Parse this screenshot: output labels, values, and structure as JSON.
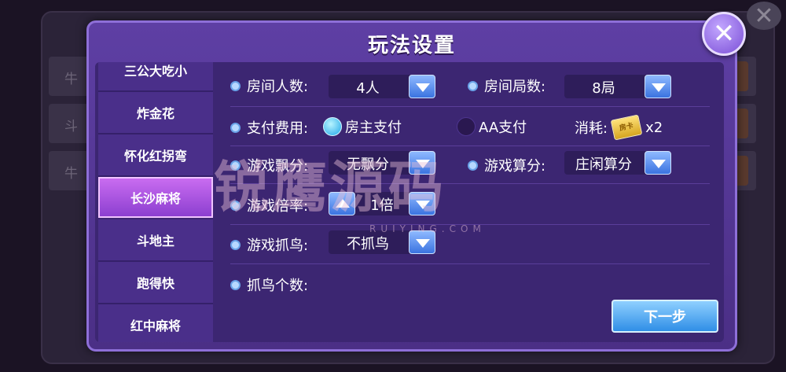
{
  "background": {
    "rows": [
      "牛",
      "斗",
      "牛"
    ],
    "close_symbol": "✕"
  },
  "dialog": {
    "title": "玩法设置",
    "close_symbol": "✕"
  },
  "sidebar": {
    "items": [
      {
        "label": "三公大吃小",
        "active": false
      },
      {
        "label": "炸金花",
        "active": false
      },
      {
        "label": "怀化红拐弯",
        "active": false
      },
      {
        "label": "长沙麻将",
        "active": true
      },
      {
        "label": "斗地主",
        "active": false
      },
      {
        "label": "跑得快",
        "active": false
      },
      {
        "label": "红中麻将",
        "active": false
      }
    ]
  },
  "options": {
    "players": {
      "label": "房间人数:",
      "value": "4人"
    },
    "rounds": {
      "label": "房间局数:",
      "value": "8局"
    },
    "payment": {
      "label": "支付费用:",
      "choices": [
        {
          "label": "房主支付",
          "selected": true
        },
        {
          "label": "AA支付",
          "selected": false
        }
      ],
      "cost_label": "消耗:",
      "cost_icon": "room-card-icon",
      "cost_value": "x2"
    },
    "float": {
      "label": "游戏飘分:",
      "value": "无飘分"
    },
    "scoring": {
      "label": "游戏算分:",
      "value": "庄闲算分"
    },
    "multiplier": {
      "label": "游戏倍率:",
      "value": "1倍"
    },
    "catch_bird": {
      "label": "游戏抓鸟:",
      "value": "不抓鸟"
    },
    "bird_count": {
      "label": "抓鸟个数:"
    }
  },
  "next_button": "下一步",
  "watermark": {
    "text": "锐鹰源码",
    "sub": "RUIYING.COM"
  }
}
